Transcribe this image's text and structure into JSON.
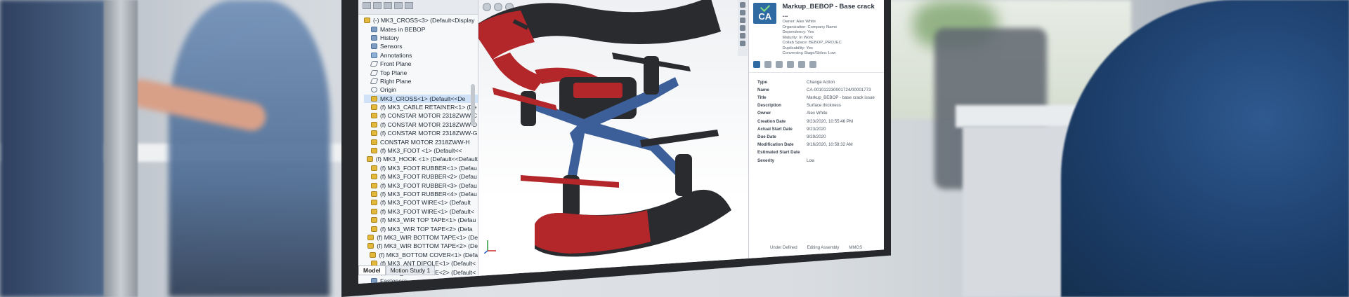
{
  "tree": {
    "items": [
      {
        "label": "(-) MK3_CROSS<3> (Default<Display",
        "icon": "part-icon",
        "indent": 0
      },
      {
        "label": "Mates in BEBOP",
        "icon": "folder-icon",
        "indent": 1
      },
      {
        "label": "History",
        "icon": "folder-icon",
        "indent": 1
      },
      {
        "label": "Sensors",
        "icon": "folder-icon",
        "indent": 1
      },
      {
        "label": "Annotations",
        "icon": "note-icon",
        "indent": 1
      },
      {
        "label": "Front Plane",
        "icon": "plane-icon",
        "indent": 1
      },
      {
        "label": "Top Plane",
        "icon": "plane-icon",
        "indent": 1
      },
      {
        "label": "Right Plane",
        "icon": "plane-icon",
        "indent": 1
      },
      {
        "label": "Origin",
        "icon": "origin-icon",
        "indent": 1
      },
      {
        "label": "MK3_CROSS<1> (Default<<De",
        "icon": "part-icon",
        "indent": 1,
        "selected": true
      },
      {
        "label": "(f) MK3_CABLE RETAINER<1> (De",
        "icon": "part-icon",
        "indent": 1
      },
      {
        "label": "(f) CONSTAR MOTOR 2318ZWW-C",
        "icon": "part-icon",
        "indent": 1
      },
      {
        "label": "(f) CONSTAR MOTOR 2318ZWW-D",
        "icon": "part-icon",
        "indent": 1
      },
      {
        "label": "(f) CONSTAR MOTOR 2318ZWW-G",
        "icon": "part-icon",
        "indent": 1
      },
      {
        "label": "CONSTAR MOTOR 2318ZWW-H",
        "icon": "part-icon",
        "indent": 1
      },
      {
        "label": "(f) MK3_FOOT <1> (Default<<",
        "icon": "part-icon",
        "indent": 1
      },
      {
        "label": "(f) MK3_HOOK <1> (Default<<Default",
        "icon": "part-icon",
        "indent": 1
      },
      {
        "label": "(f) MK3_FOOT RUBBER<1> (Defau",
        "icon": "part-icon",
        "indent": 1
      },
      {
        "label": "(f) MK3_FOOT RUBBER<2> (Defau",
        "icon": "part-icon",
        "indent": 1
      },
      {
        "label": "(f) MK3_FOOT RUBBER<3> (Defau",
        "icon": "part-icon",
        "indent": 1
      },
      {
        "label": "(f) MK3_FOOT RUBBER<4> (Defau",
        "icon": "part-icon",
        "indent": 1
      },
      {
        "label": "(f) MK3_FOOT WIRE<1> (Default",
        "icon": "part-icon",
        "indent": 1
      },
      {
        "label": "(f) MK3_FOOT WIRE<1> (Default<",
        "icon": "part-icon",
        "indent": 1
      },
      {
        "label": "(f) MK3_WIR TOP TAPE<1> (Defau",
        "icon": "part-icon",
        "indent": 1
      },
      {
        "label": "(f) MK3_WIR TOP TAPE<2> (Defa",
        "icon": "part-icon",
        "indent": 1
      },
      {
        "label": "(f) MK3_WIR BOTTOM TAPE<1> (De",
        "icon": "part-icon",
        "indent": 1
      },
      {
        "label": "(f) MK3_WIR BOTTOM TAPE<2> (De",
        "icon": "part-icon",
        "indent": 1
      },
      {
        "label": "(f) MK3_BOTTOM COVER<1> (Defa",
        "icon": "part-icon",
        "indent": 1
      },
      {
        "label": "(f) MK3_ANT DIPOLE<1> (Default<",
        "icon": "part-icon",
        "indent": 1
      },
      {
        "label": "(f) MK3_ANT DIPOLE<2> (Default<",
        "icon": "part-icon",
        "indent": 1
      },
      {
        "label": "Fasteners",
        "icon": "folder-icon",
        "indent": 1
      }
    ],
    "tabs": [
      "Model",
      "Motion Study 1"
    ]
  },
  "panel": {
    "title": "Markup_BEBOP - Base crack ...",
    "badge": "CA",
    "meta": [
      "Owner: Alex White",
      "Organization: Company Name",
      "Dependency: Yes",
      "Maturity: In Work",
      "Collab Space: BEBOP_PROJEC",
      "Duplicability: Yes",
      "Conversing Stage/Sides: Low"
    ],
    "fields": [
      {
        "k": "Type",
        "v": "Change Action"
      },
      {
        "k": "Name",
        "v": "CA-001012230001724/00001773"
      },
      {
        "k": "Title",
        "v": "Markup_BEBOP - base crack issue"
      },
      {
        "k": "Description",
        "v": "Surface thickness"
      },
      {
        "k": "Owner",
        "v": "Alex White"
      },
      {
        "k": "Creation Date",
        "v": "9/23/2020, 10:55:46 PM"
      },
      {
        "k": "Actual Start Date",
        "v": "9/23/2020"
      },
      {
        "k": "Due Date",
        "v": "9/29/2020"
      },
      {
        "k": "Modification Date",
        "v": "9/16/2020, 10:58:32 AM"
      },
      {
        "k": "Estimated Start Date",
        "v": ""
      },
      {
        "k": "Severity",
        "v": "Low"
      }
    ],
    "status": [
      "Under Defined",
      "Editing Assembly",
      "MMGS"
    ]
  },
  "colors": {
    "accent": "#2f6aa3",
    "drone_red": "#b3262a",
    "drone_blue": "#3c5f9a",
    "drone_black": "#2a2b2e"
  }
}
